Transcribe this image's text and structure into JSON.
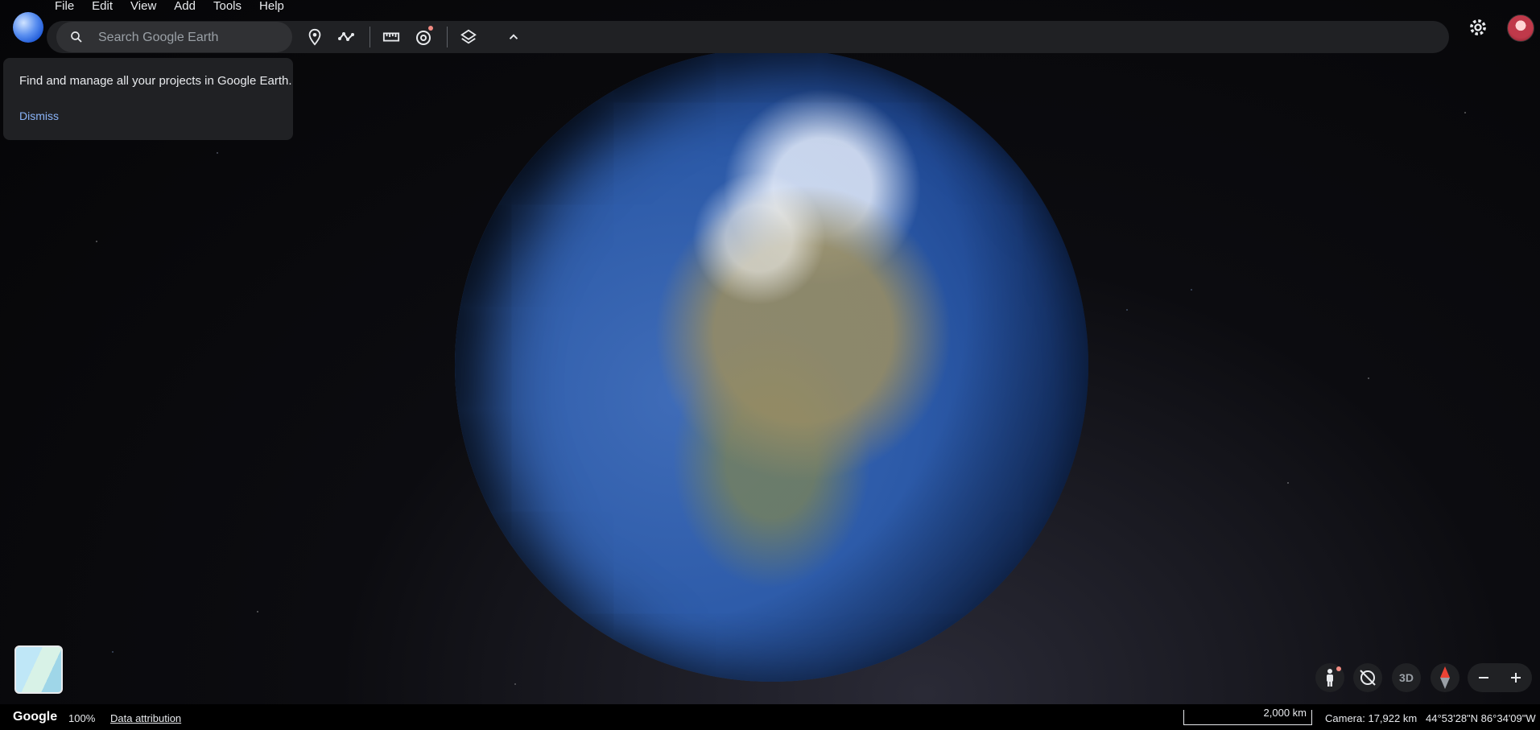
{
  "menu": [
    "File",
    "Edit",
    "View",
    "Add",
    "Tools",
    "Help"
  ],
  "search": {
    "placeholder": "Search Google Earth"
  },
  "toolbar": {
    "icons": [
      "place-marker-icon",
      "path-icon",
      "ruler-icon",
      "voyager-icon",
      "layers-icon",
      "collapse-chevron-icon"
    ]
  },
  "popup": {
    "message": "Find and manage all your projects in Google Earth.",
    "dismiss": "Dismiss"
  },
  "controls": {
    "mode_3d": "3D"
  },
  "status": {
    "brand": "Google",
    "zoom": "100%",
    "attribution": "Data attribution",
    "scale": "2,000 km",
    "camera": "Camera: 17,922 km",
    "coordinates": "44°53'28\"N 86°34'09\"W"
  },
  "colors": {
    "toolbar_bg": "#202124",
    "link": "#8ab4f8",
    "accent_red": "#f28b82"
  }
}
